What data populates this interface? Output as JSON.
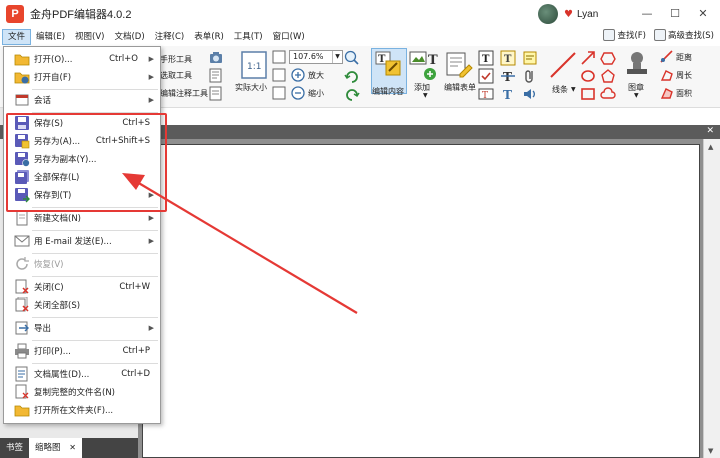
{
  "window": {
    "title": "金舟PDF编辑器4.0.2",
    "logo_letter": "P",
    "user_name": "Lyan",
    "min_label": "—",
    "max_label": "☐",
    "close_label": "✕"
  },
  "menubar": {
    "items": [
      "文件",
      "编辑(E)",
      "视图(V)",
      "文档(D)",
      "注释(C)",
      "表单(R)",
      "工具(T)",
      "窗口(W)"
    ],
    "find_label": "查找(F)",
    "advanced_find_label": "高级查找(S)"
  },
  "toolbar": {
    "hand_tool": "手形工具",
    "select_text": "选取工具",
    "edit_annot_tool": "编辑注释工具",
    "actual_size": "实际大小",
    "zoom_value": "107.6%",
    "zoom_in": "放大",
    "zoom_out": "缩小",
    "edit_content": "编辑内容",
    "add": "添加",
    "edit_form": "编辑表单",
    "lines": "线条",
    "stamp": "图章",
    "distance": "距离",
    "perimeter": "周长",
    "area": "面积"
  },
  "file_menu": {
    "items": [
      {
        "label": "打开(O)...",
        "shortcut": "Ctrl+O",
        "submenu": true,
        "icon": "open-folder-icon"
      },
      {
        "label": "打开自(F)",
        "shortcut": "",
        "submenu": true,
        "icon": "open-from-icon"
      },
      {
        "label": "会话",
        "shortcut": "",
        "submenu": true,
        "icon": "session-icon"
      },
      {
        "label": "保存(S)",
        "shortcut": "Ctrl+S",
        "submenu": false,
        "icon": "save-icon"
      },
      {
        "label": "另存为(A)...",
        "shortcut": "Ctrl+Shift+S",
        "submenu": false,
        "icon": "save-as-icon"
      },
      {
        "label": "另存为副本(Y)...",
        "shortcut": "",
        "submenu": false,
        "icon": "save-copy-icon"
      },
      {
        "label": "全部保存(L)",
        "shortcut": "",
        "submenu": false,
        "icon": "save-all-icon"
      },
      {
        "label": "保存到(T)",
        "shortcut": "",
        "submenu": true,
        "icon": "save-to-icon"
      },
      {
        "label": "新建文档(N)",
        "shortcut": "",
        "submenu": true,
        "icon": "new-doc-icon"
      },
      {
        "label": "用 E-mail 发送(E)...",
        "shortcut": "",
        "submenu": true,
        "icon": "email-icon"
      },
      {
        "label": "恢复(V)",
        "shortcut": "",
        "submenu": false,
        "icon": "revert-icon",
        "disabled": true
      },
      {
        "label": "关闭(C)",
        "shortcut": "Ctrl+W",
        "submenu": false,
        "icon": "close-doc-icon"
      },
      {
        "label": "关闭全部(S)",
        "shortcut": "",
        "submenu": false,
        "icon": "close-all-icon"
      },
      {
        "label": "导出",
        "shortcut": "",
        "submenu": true,
        "icon": "export-icon"
      },
      {
        "label": "打印(P)...",
        "shortcut": "Ctrl+P",
        "submenu": false,
        "icon": "print-icon"
      },
      {
        "label": "文档属性(D)...",
        "shortcut": "Ctrl+D",
        "submenu": false,
        "icon": "properties-icon"
      },
      {
        "label": "复制完整的文件名(N)",
        "shortcut": "",
        "submenu": false,
        "icon": "copy-filename-icon"
      },
      {
        "label": "打开所在文件夹(F)...",
        "shortcut": "",
        "submenu": false,
        "icon": "open-containing-folder-icon"
      }
    ]
  },
  "bottom_tabs": {
    "bookmarks": "书签",
    "thumbnails": "缩略图",
    "close_label": "✕"
  },
  "colors": {
    "highlight_red": "#e53935",
    "menu_active": "#cfe4f7",
    "dark_band": "#5b5b5b",
    "doc_background": "#8f8f8f"
  }
}
